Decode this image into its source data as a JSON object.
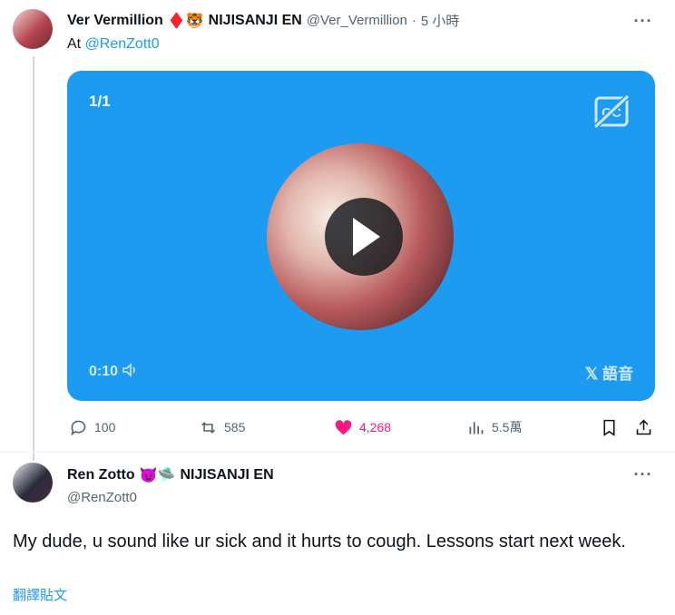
{
  "tweet": {
    "author_name": "Ver Vermillion",
    "author_emoji": "♦️🐯",
    "org": "NIJISANJI EN",
    "handle": "@Ver_Vermillion",
    "separator": "·",
    "time": "5 小時",
    "text_prefix": "At ",
    "mention": "@RenZott0",
    "media": {
      "counter": "1/1",
      "duration": "0:10",
      "voice_label": "語音",
      "cc_icon": "closed-captions-off-icon",
      "play_icon": "play-icon"
    },
    "actions": {
      "replies": "100",
      "reposts": "585",
      "likes": "4,268",
      "views": "5.5萬"
    },
    "colors": {
      "accent": "#1d9bf0",
      "like": "#f91880",
      "muted": "#536471"
    }
  },
  "reply": {
    "author_name": "Ren Zotto",
    "author_emoji": "😈🛸",
    "org": "NIJISANJI EN",
    "handle": "@RenZott0",
    "text": "My dude, u sound like ur sick and it hurts to cough. Lessons start next week.",
    "translate": "翻譯貼文"
  }
}
